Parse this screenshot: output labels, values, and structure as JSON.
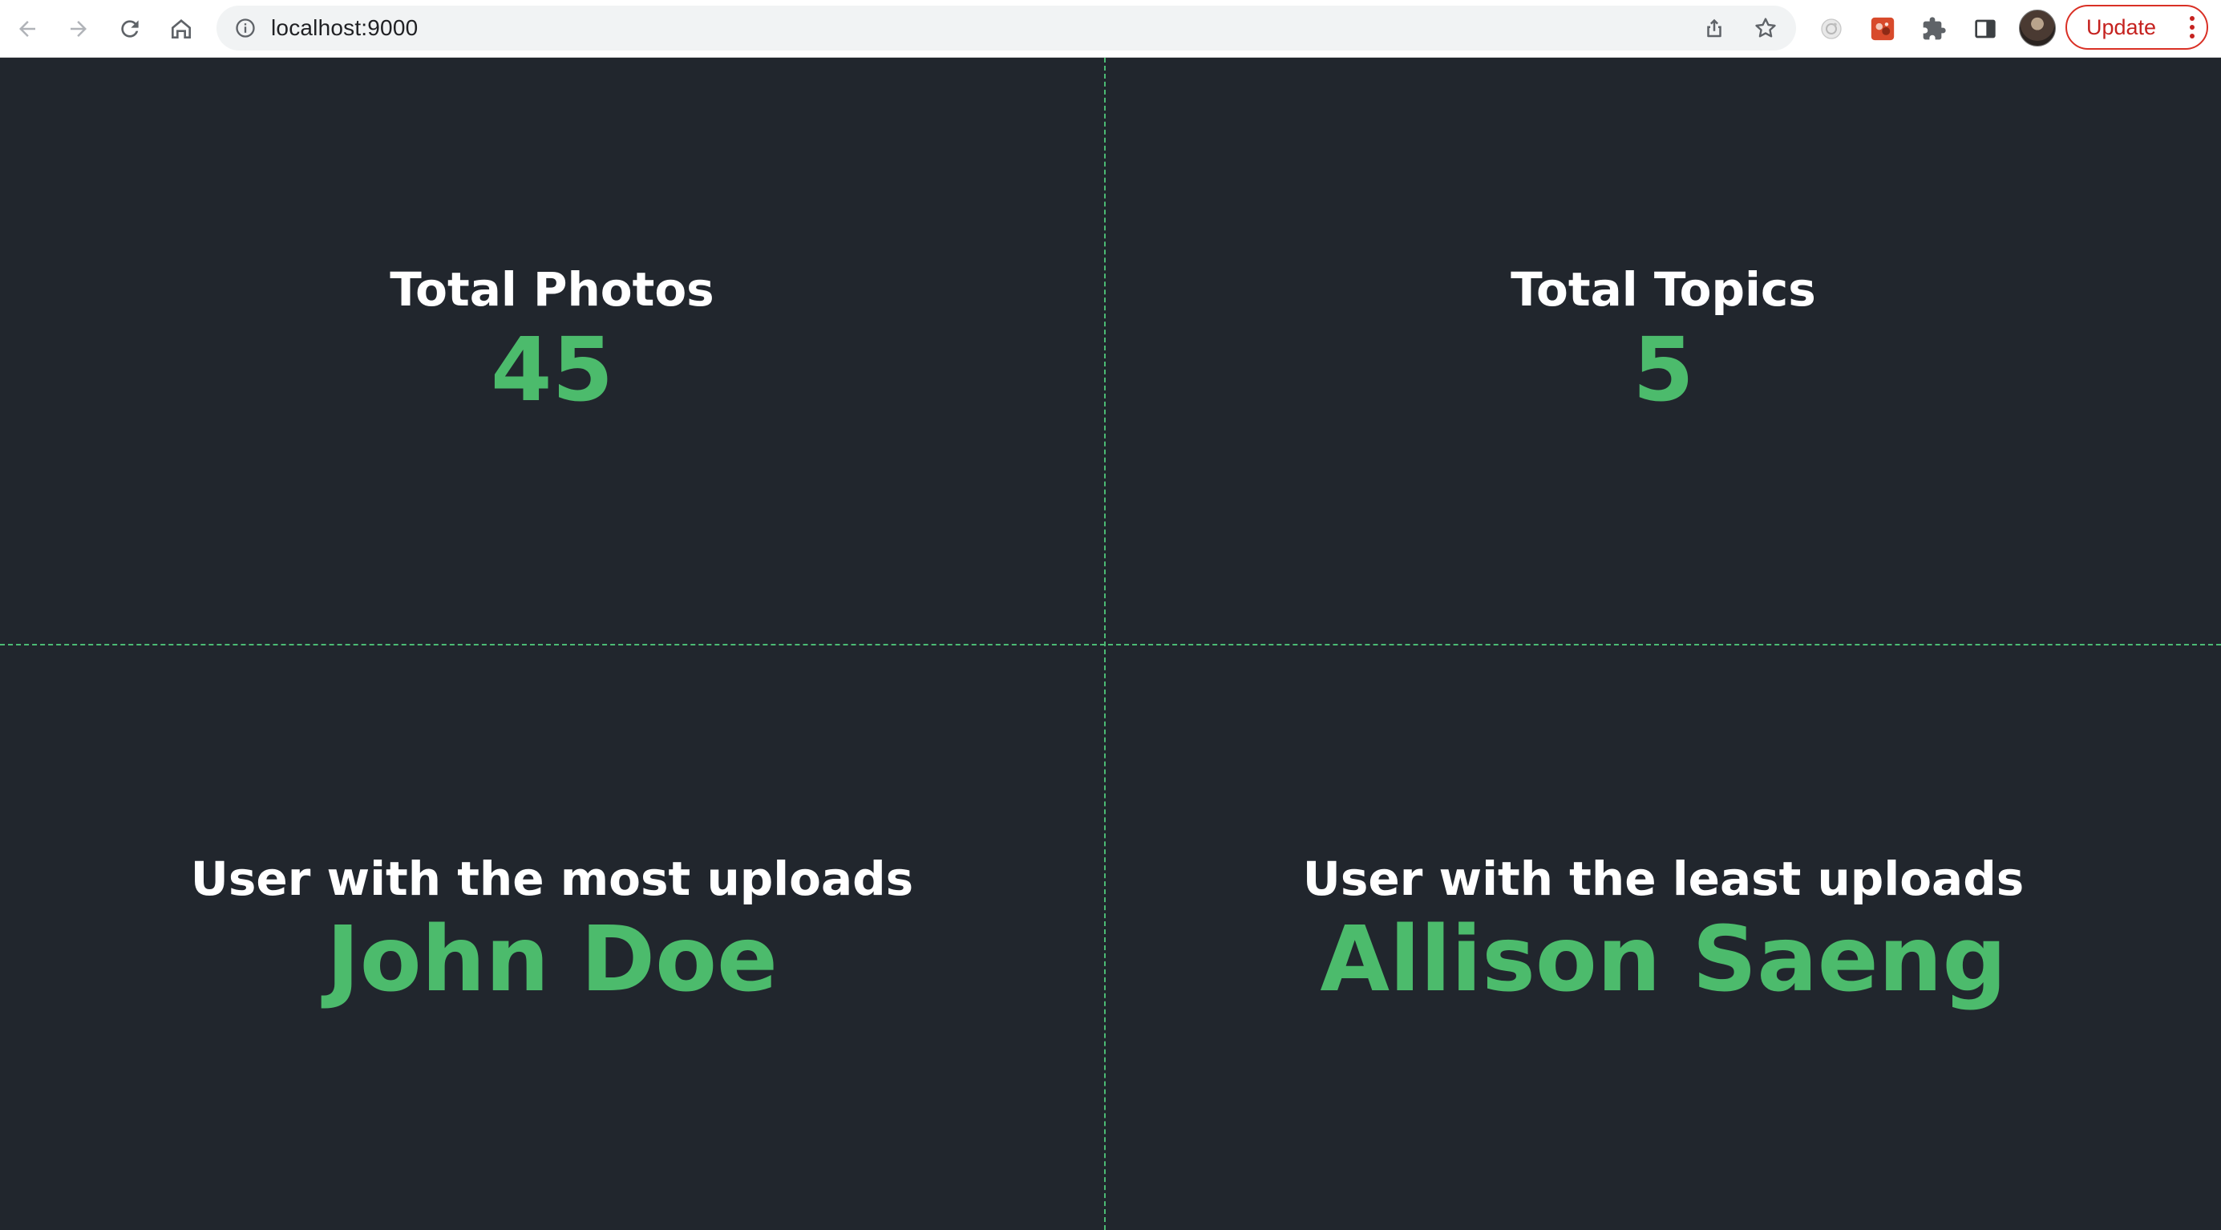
{
  "browser": {
    "url": "localhost:9000",
    "update_label": "Update"
  },
  "stats": {
    "total_photos": {
      "label": "Total Photos",
      "value": "45"
    },
    "total_topics": {
      "label": "Total Topics",
      "value": "5"
    },
    "most_uploads": {
      "label": "User with the most uploads",
      "value": "John Doe"
    },
    "least_uploads": {
      "label": "User with the least uploads",
      "value": "Allison Saeng"
    }
  },
  "colors": {
    "background": "#21262d",
    "accent": "#4cbb6c",
    "title": "#ffffff",
    "update_red": "#c5221f"
  },
  "icons": {
    "back": "arrow-left-icon",
    "forward": "arrow-right-icon",
    "reload": "reload-icon",
    "home": "home-icon",
    "info": "info-icon",
    "share": "share-icon",
    "bookmark": "star-icon",
    "extension1": "camera-extension-icon",
    "extension2": "red-extension-icon",
    "extensions": "puzzle-icon",
    "side_panel": "side-panel-icon",
    "menu": "kebab-menu-icon"
  }
}
